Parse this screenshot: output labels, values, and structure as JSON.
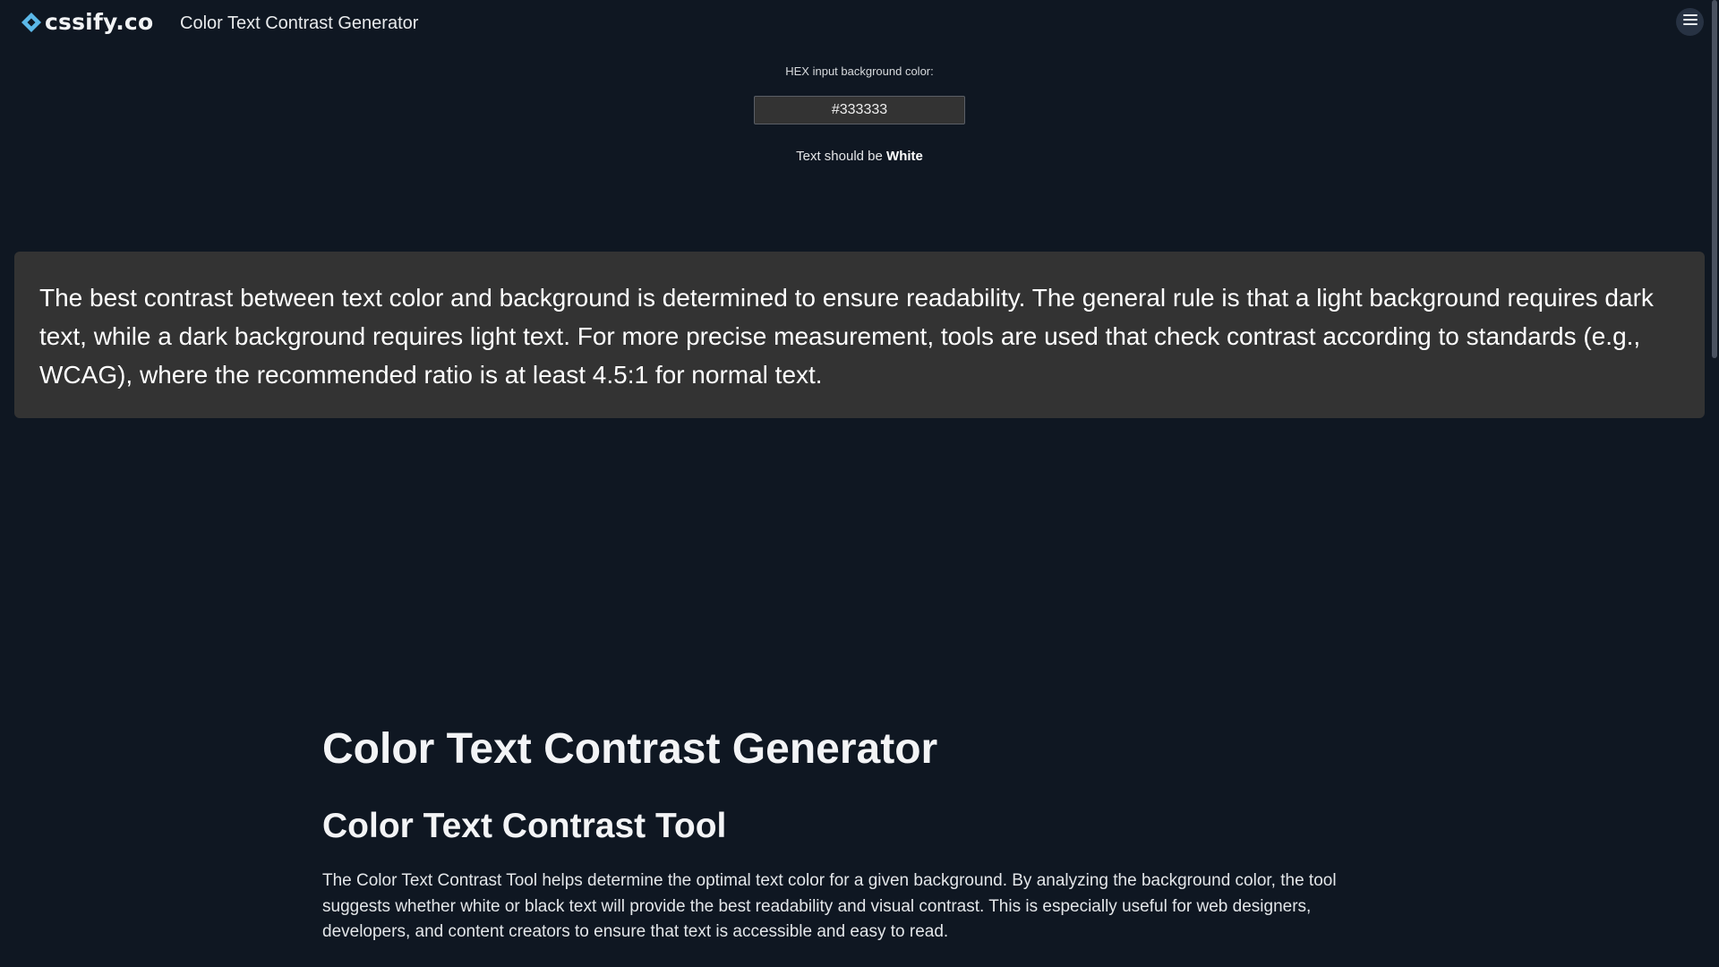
{
  "header": {
    "logo_text": "cssify.co",
    "title": "Color Text Contrast Generator",
    "menu_icon": "hamburger-menu-icon"
  },
  "tool": {
    "hex_label": "HEX input background color:",
    "hex_value": "#333333",
    "result_prefix": "Text should be",
    "result_value": "White"
  },
  "preview": {
    "background_color": "#333333",
    "text_color": "#ffffff",
    "text": "The best contrast between text color and background is determined to ensure readability. The general rule is that a light background requires dark text, while a dark background requires light text. For more precise measurement, tools are used that check contrast according to standards (e.g., WCAG), where the recommended ratio is at least 4.5:1 for normal text."
  },
  "article": {
    "h1": "Color Text Contrast Generator",
    "h2": "Color Text Contrast Tool",
    "paragraph": "The Color Text Contrast Tool helps determine the optimal text color for a given background. By analyzing the background color, the tool suggests whether white or black text will provide the best readability and visual contrast. This is especially useful for web designers, developers, and content creators to ensure that text is accessible and easy to read."
  },
  "colors": {
    "page_background": "#0f1722",
    "logo_accent": "#5bb8e8",
    "menu_button_bg": "#273243"
  }
}
